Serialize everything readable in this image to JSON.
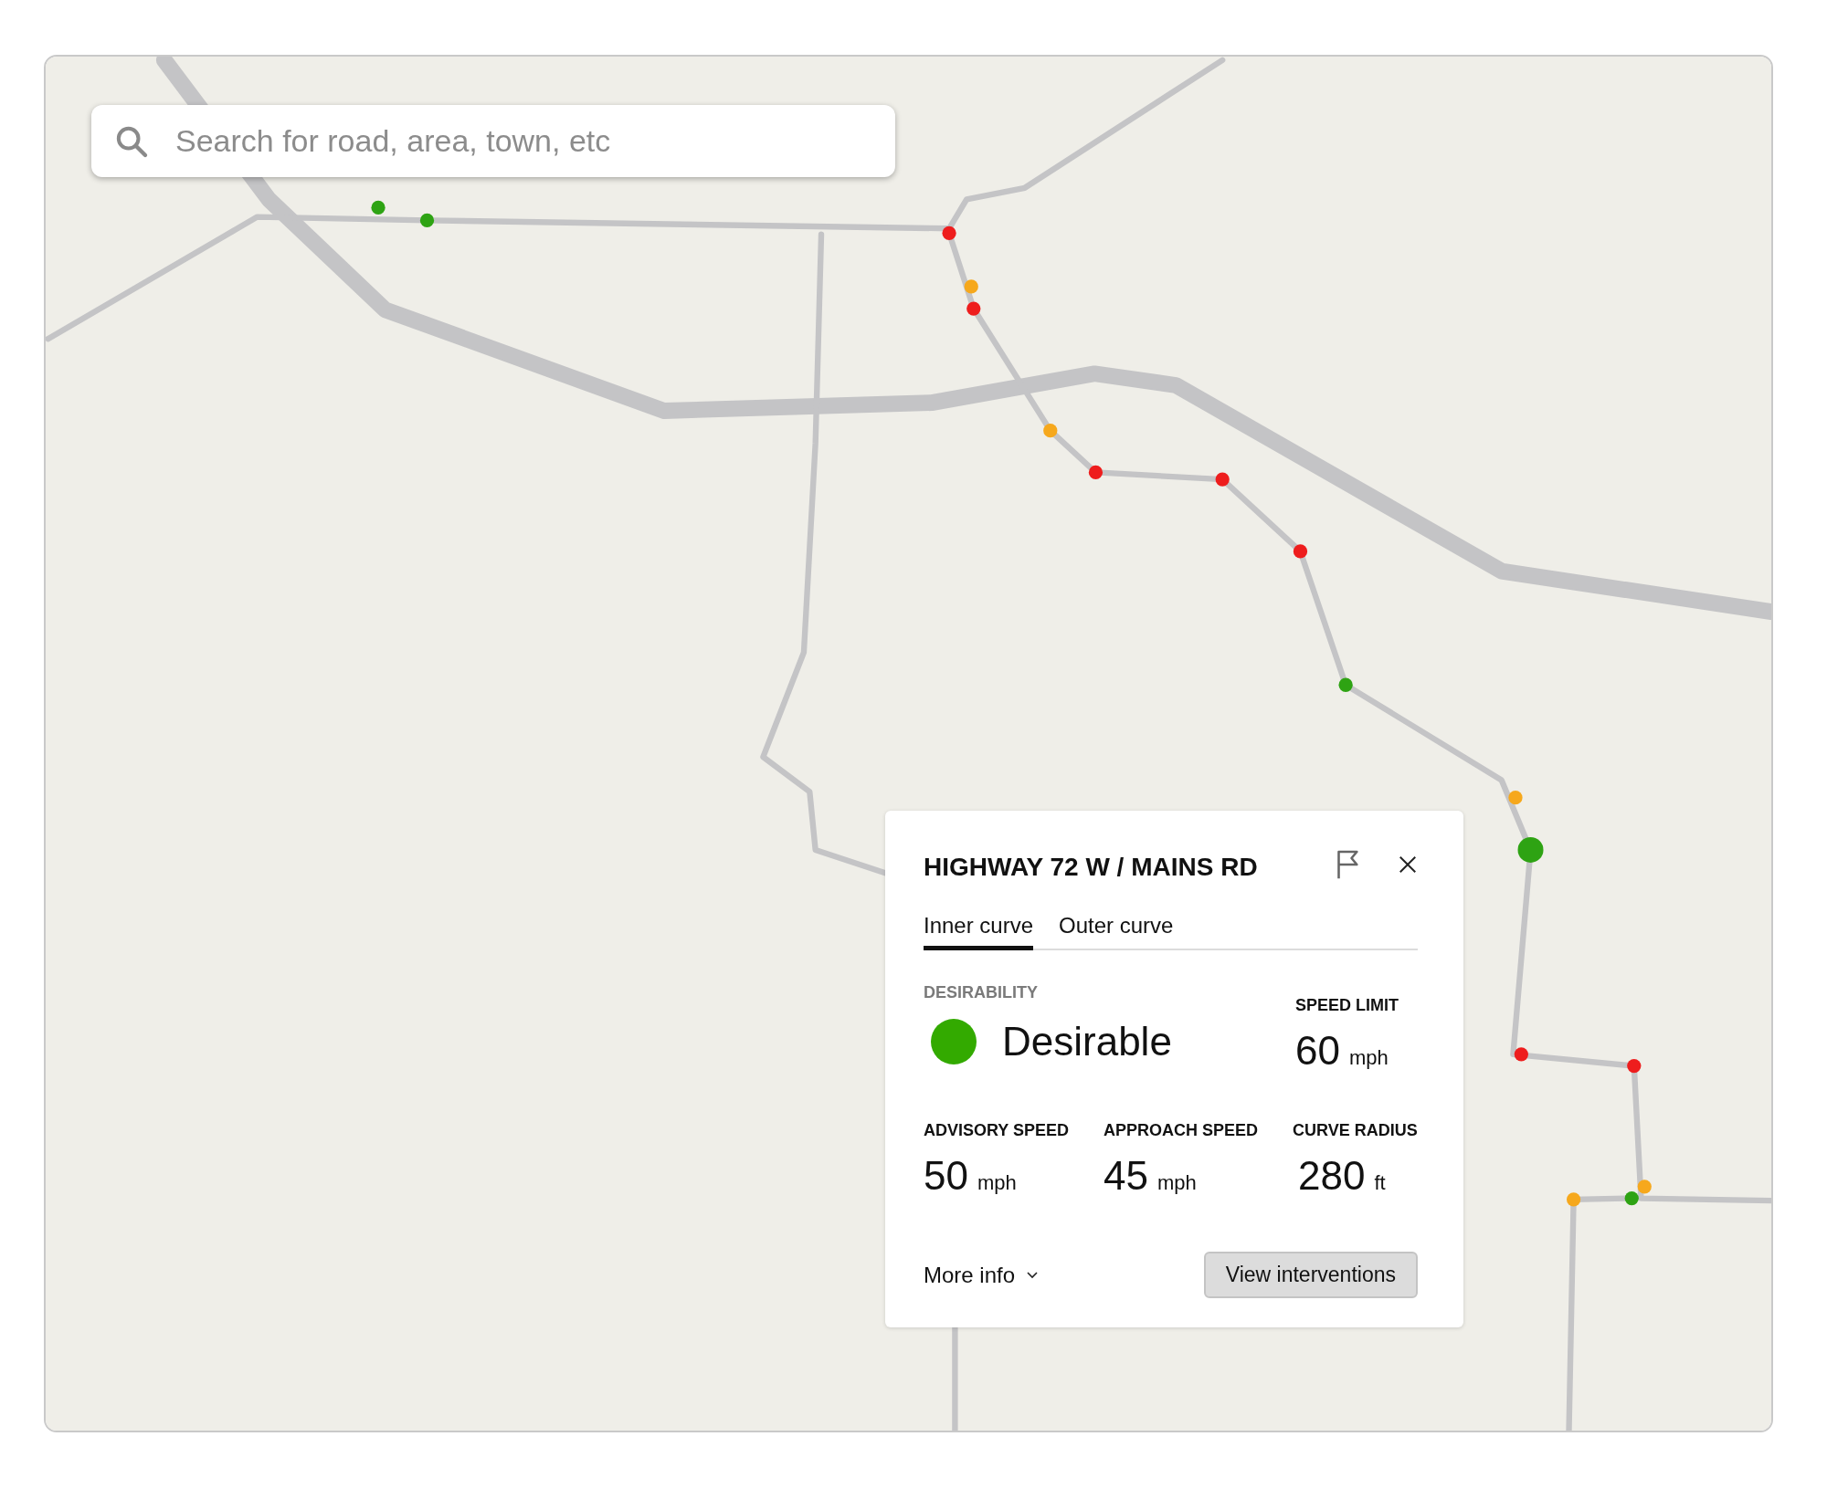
{
  "search": {
    "placeholder": "Search for road, area, town, etc"
  },
  "markers": [
    {
      "color": "#2ea313",
      "selected": false
    },
    {
      "color": "#2ea313",
      "selected": false
    },
    {
      "color": "#ee1d1d",
      "selected": false
    },
    {
      "color": "#f6a81c",
      "selected": false
    },
    {
      "color": "#ee1d1d",
      "selected": false
    },
    {
      "color": "#f6a81c",
      "selected": false
    },
    {
      "color": "#ee1d1d",
      "selected": false
    },
    {
      "color": "#ee1d1d",
      "selected": false
    },
    {
      "color": "#ee1d1d",
      "selected": false
    },
    {
      "color": "#2ea313",
      "selected": false
    },
    {
      "color": "#f6a81c",
      "selected": false
    },
    {
      "color": "#2ea313",
      "selected": true
    },
    {
      "color": "#ee1d1d",
      "selected": false
    },
    {
      "color": "#ee1d1d",
      "selected": false
    },
    {
      "color": "#f6a81c",
      "selected": false
    },
    {
      "color": "#2ea313",
      "selected": false
    },
    {
      "color": "#f6a81c",
      "selected": false
    }
  ],
  "popup": {
    "title": "HIGHWAY 72 W / MAINS RD",
    "tabs": [
      {
        "label": "Inner curve",
        "selected": true
      },
      {
        "label": "Outer curve",
        "selected": false
      }
    ],
    "desirability": {
      "label": "DESIRABILITY",
      "value": "Desirable",
      "color": "#33aa00"
    },
    "metrics": [
      {
        "label": "SPEED LIMIT",
        "value": "60",
        "unit": "mph"
      },
      {
        "label": "ADVISORY SPEED",
        "value": "50",
        "unit": "mph"
      },
      {
        "label": "APPROACH SPEED",
        "value": "45",
        "unit": "mph"
      },
      {
        "label": "CURVE RADIUS",
        "value": "280",
        "unit": "ft"
      }
    ],
    "more_info": "More info",
    "button": "View interventions"
  }
}
